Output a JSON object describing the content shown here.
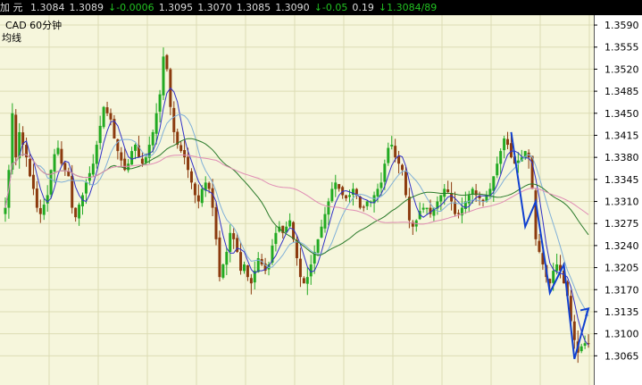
{
  "header": {
    "name": "加 元",
    "fields": [
      "1.3084",
      "1.3089",
      "-0.0006",
      "1.3095",
      "1.3070",
      "1.3085",
      "1.3090",
      "-0.05",
      "0.19",
      "1.3084/89"
    ],
    "field_colors": [
      "#dcdcdc",
      "#dcdcdc",
      "#22c022",
      "#dcdcdc",
      "#dcdcdc",
      "#dcdcdc",
      "#dcdcdc",
      "#22c022",
      "#dcdcdc",
      "#22c022"
    ],
    "arrows": [
      "",
      "",
      "↓",
      "",
      "",
      "",
      "",
      "↓",
      "",
      "↓"
    ]
  },
  "chart_info": {
    "symbol": "CAD",
    "period": "60分钟",
    "ma_label": "均线"
  },
  "colors": {
    "plot_bg": "#f6f6dc",
    "grid": "#dcdcb4",
    "candle_up": "#22aa22",
    "candle_down": "#8b3a0e",
    "ma_short": "#3030c8",
    "ma_mid": "#80b0d8",
    "ma_long": "#2a7a2a",
    "ma_longest": "#e08cb4",
    "drawing": "#1040d0"
  },
  "chart_data": {
    "type": "candlestick",
    "title": "",
    "ylim": [
      1.303,
      1.36
    ],
    "yticks": [
      "1.3590",
      "1.3555",
      "1.3520",
      "1.3485",
      "1.3450",
      "1.3415",
      "1.3380",
      "1.3345",
      "1.3310",
      "1.3275",
      "1.3240",
      "1.3205",
      "1.3170",
      "1.3135",
      "1.3100",
      "1.3065"
    ],
    "grid": true,
    "bar_count": 165,
    "close": [
      1.33,
      1.336,
      1.345,
      1.338,
      1.342,
      1.34,
      1.338,
      1.335,
      1.333,
      1.33,
      1.329,
      1.3305,
      1.332,
      1.336,
      1.3385,
      1.3395,
      1.337,
      1.336,
      1.335,
      1.33,
      1.3285,
      1.3305,
      1.332,
      1.334,
      1.3355,
      1.337,
      1.34,
      1.343,
      1.346,
      1.345,
      1.344,
      1.341,
      1.339,
      1.3375,
      1.336,
      1.337,
      1.339,
      1.34,
      1.338,
      1.337,
      1.338,
      1.34,
      1.342,
      1.345,
      1.348,
      1.354,
      1.352,
      1.346,
      1.342,
      1.34,
      1.339,
      1.338,
      1.336,
      1.334,
      1.332,
      1.331,
      1.333,
      1.334,
      1.333,
      1.33,
      1.325,
      1.319,
      1.321,
      1.323,
      1.326,
      1.325,
      1.323,
      1.32,
      1.321,
      1.319,
      1.318,
      1.32,
      1.322,
      1.321,
      1.32,
      1.321,
      1.324,
      1.326,
      1.327,
      1.326,
      1.327,
      1.328,
      1.325,
      1.322,
      1.319,
      1.318,
      1.319,
      1.321,
      1.323,
      1.325,
      1.327,
      1.329,
      1.331,
      1.333,
      1.334,
      1.333,
      1.332,
      1.3315,
      1.332,
      1.333,
      1.332,
      1.33,
      1.33,
      1.331,
      1.331,
      1.332,
      1.333,
      1.334,
      1.337,
      1.3395,
      1.34,
      1.338,
      1.337,
      1.336,
      1.332,
      1.328,
      1.327,
      1.328,
      1.3295,
      1.33,
      1.33,
      1.329,
      1.33,
      1.331,
      1.332,
      1.333,
      1.3325,
      1.331,
      1.329,
      1.329,
      1.33,
      1.331,
      1.332,
      1.333,
      1.332,
      1.3315,
      1.331,
      1.332,
      1.333,
      1.335,
      1.337,
      1.339,
      1.341,
      1.34,
      1.338,
      1.337,
      1.3375,
      1.338,
      1.339,
      1.338,
      1.333,
      1.325,
      1.323,
      1.321,
      1.319,
      1.318,
      1.32,
      1.321,
      1.32,
      1.318,
      1.316,
      1.312,
      1.309,
      1.307,
      1.308,
      1.3085,
      1.3084
    ]
  }
}
